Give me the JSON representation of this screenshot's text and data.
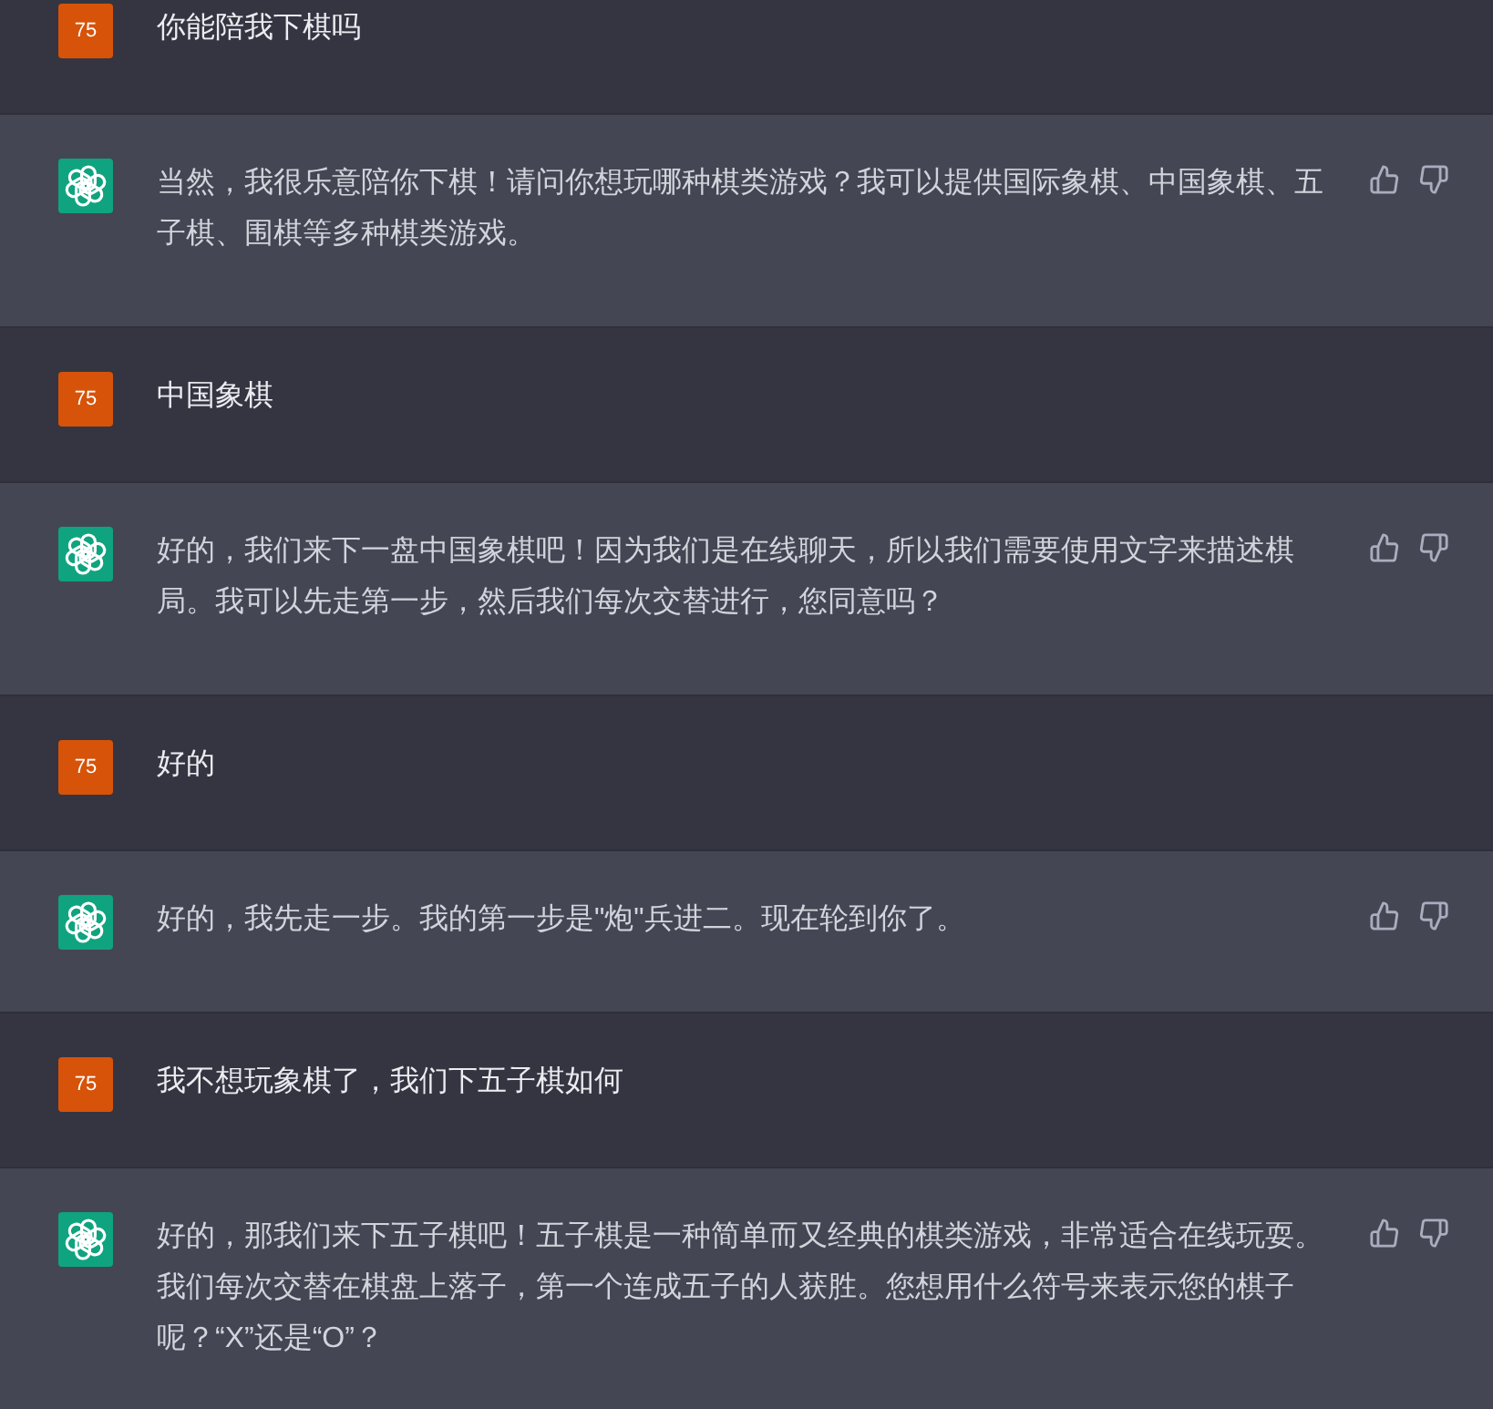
{
  "messages": [
    {
      "kind": "user",
      "avatar_text": "75",
      "text": "你能陪我下棋吗"
    },
    {
      "kind": "assistant",
      "text": "当然，我很乐意陪你下棋！请问你想玩哪种棋类游戏？我可以提供国际象棋、中国象棋、五子棋、围棋等多种棋类游戏。"
    },
    {
      "kind": "user",
      "avatar_text": "75",
      "text": "中国象棋"
    },
    {
      "kind": "assistant",
      "text": "好的，我们来下一盘中国象棋吧！因为我们是在线聊天，所以我们需要使用文字来描述棋局。我可以先走第一步，然后我们每次交替进行，您同意吗？"
    },
    {
      "kind": "user",
      "avatar_text": "75",
      "text": "好的"
    },
    {
      "kind": "assistant",
      "text": "好的，我先走一步。我的第一步是\"炮\"兵进二。现在轮到你了。"
    },
    {
      "kind": "user",
      "avatar_text": "75",
      "text": "我不想玩象棋了，我们下五子棋如何"
    },
    {
      "kind": "assistant",
      "text": "好的，那我们来下五子棋吧！五子棋是一种简单而又经典的棋类游戏，非常适合在线玩耍。我们每次交替在棋盘上落子，第一个连成五子的人获胜。您想用什么符号来表示您的棋子呢？“X”还是“O”？"
    }
  ]
}
